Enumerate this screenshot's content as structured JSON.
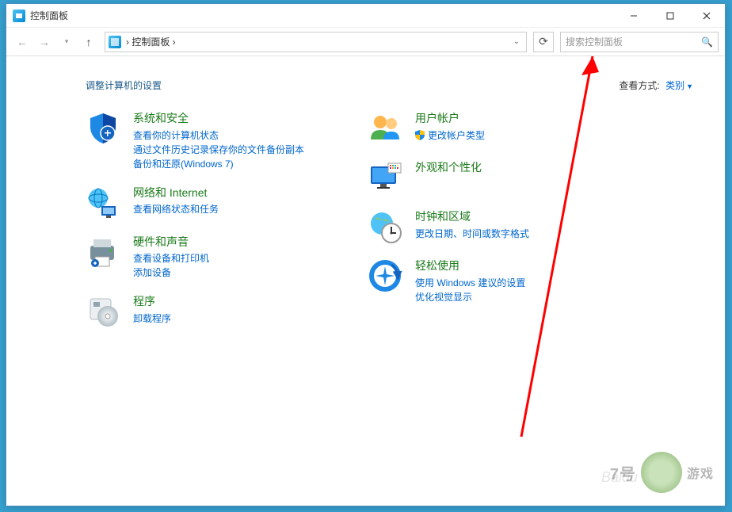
{
  "window": {
    "title": "控制面板"
  },
  "nav": {
    "breadcrumb": "›  控制面板  ›"
  },
  "search": {
    "placeholder": "搜索控制面板"
  },
  "heading": "调整计算机的设置",
  "view": {
    "label": "查看方式:",
    "value": "类别"
  },
  "left": [
    {
      "title": "系统和安全",
      "links": [
        "查看你的计算机状态",
        "通过文件历史记录保存你的文件备份副本",
        "备份和还原(Windows 7)"
      ]
    },
    {
      "title": "网络和 Internet",
      "links": [
        "查看网络状态和任务"
      ]
    },
    {
      "title": "硬件和声音",
      "links": [
        "查看设备和打印机",
        "添加设备"
      ]
    },
    {
      "title": "程序",
      "links": [
        "卸载程序"
      ]
    }
  ],
  "right": [
    {
      "title": "用户帐户",
      "links": [
        "更改帐户类型"
      ],
      "shield": true
    },
    {
      "title": "外观和个性化",
      "links": []
    },
    {
      "title": "时钟和区域",
      "links": [
        "更改日期、时间或数字格式"
      ]
    },
    {
      "title": "轻松使用",
      "links": [
        "使用 Windows 建议的设置",
        "优化视觉显示"
      ]
    }
  ],
  "watermark": {
    "brand": "7号",
    "sub": "游戏"
  }
}
